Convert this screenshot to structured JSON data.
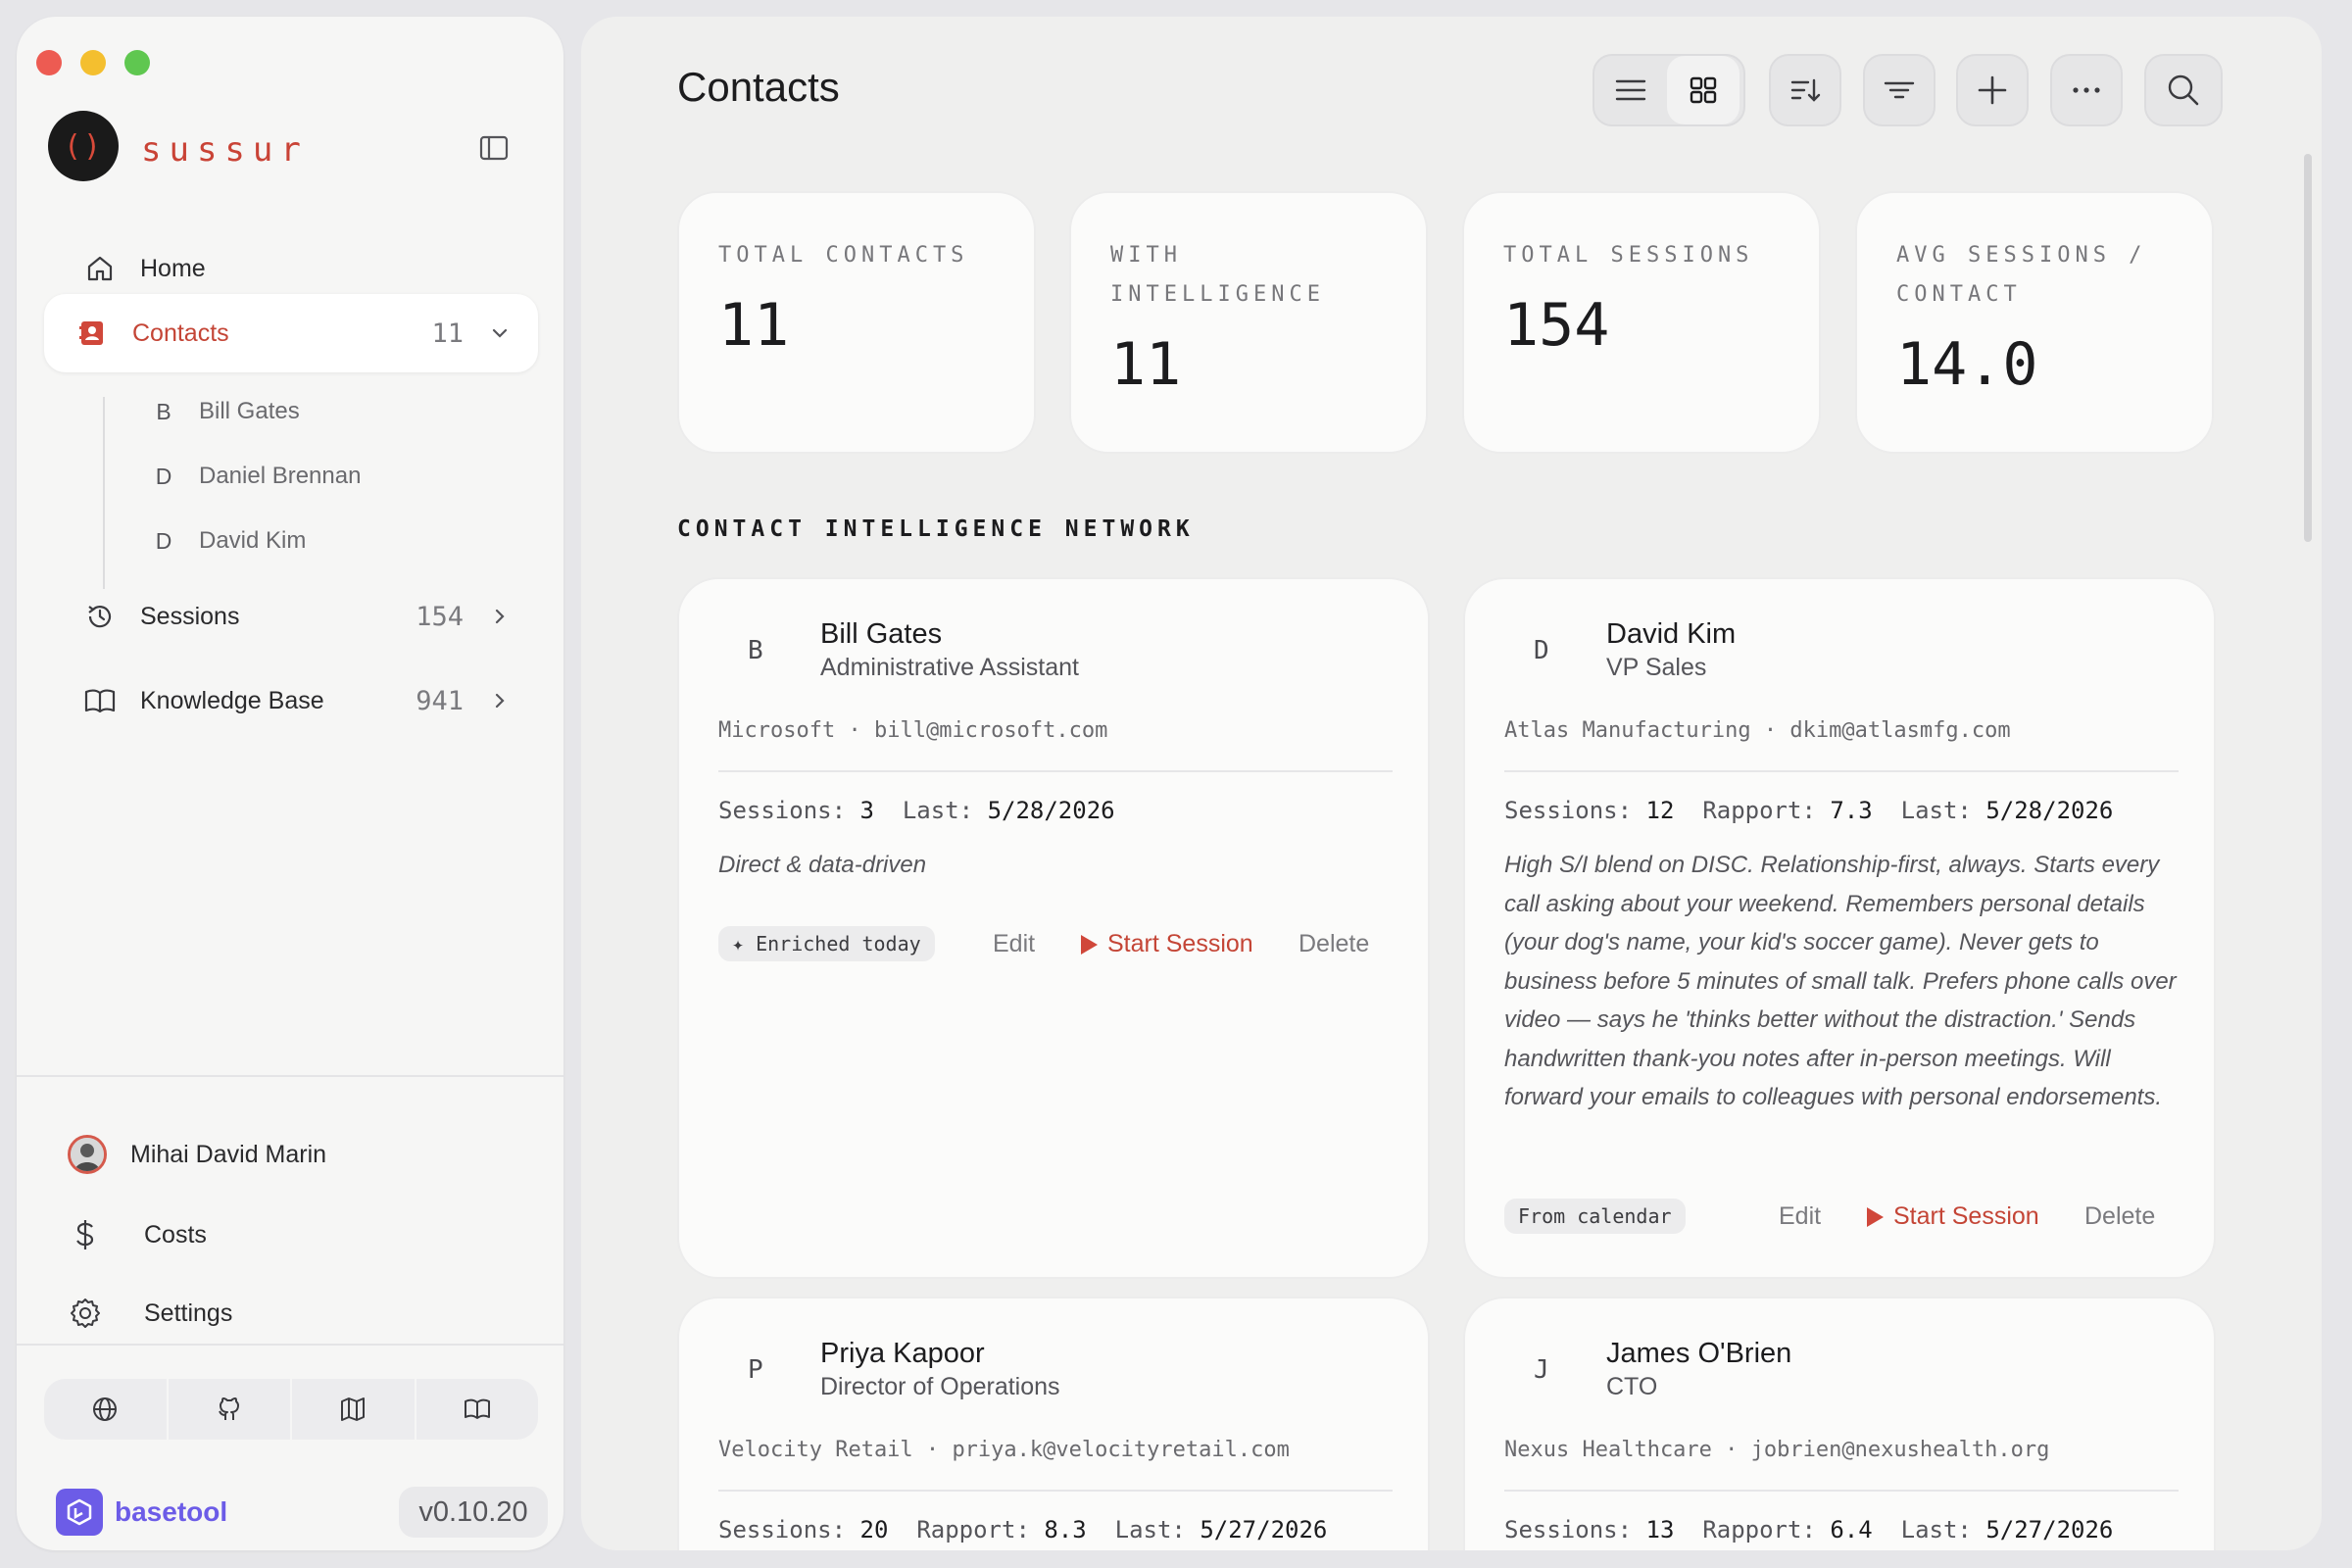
{
  "app": {
    "brand": "sussur",
    "logo_glyph": "()",
    "accent_color": "#c44536"
  },
  "sidebar": {
    "nav": [
      {
        "label": "Home",
        "icon": "home-icon"
      },
      {
        "label": "Contacts",
        "count": "11",
        "icon": "contacts-icon",
        "active": true
      },
      {
        "label": "Sessions",
        "count": "154",
        "icon": "history-icon"
      },
      {
        "label": "Knowledge Base",
        "count": "941",
        "icon": "book-icon"
      }
    ],
    "sub_contacts": [
      {
        "initial": "B",
        "name": "Bill Gates"
      },
      {
        "initial": "D",
        "name": "Daniel Brennan"
      },
      {
        "initial": "D",
        "name": "David Kim"
      }
    ],
    "user": {
      "name": "Mihai David Marin"
    },
    "footer": [
      {
        "label": "Costs",
        "icon": "dollar-icon"
      },
      {
        "label": "Settings",
        "icon": "gear-icon"
      }
    ],
    "links": [
      "globe-icon",
      "github-icon",
      "map-icon",
      "book-open-icon"
    ],
    "basetool": {
      "name": "basetool",
      "color": "#6c5ce7"
    },
    "version": "v0.10.20"
  },
  "main": {
    "title": "Contacts",
    "toolbar": [
      "list-view-icon",
      "grid-view-icon",
      "sort-icon",
      "filter-icon",
      "plus-icon",
      "more-icon",
      "search-icon"
    ],
    "stats": [
      {
        "label": "TOTAL CONTACTS",
        "value": "11"
      },
      {
        "label": "WITH INTELLIGENCE",
        "value": "11"
      },
      {
        "label": "TOTAL SESSIONS",
        "value": "154"
      },
      {
        "label": "AVG SESSIONS / CONTACT",
        "value": "14.0"
      }
    ],
    "section_title": "CONTACT INTELLIGENCE NETWORK",
    "contacts": [
      {
        "initial": "B",
        "name": "Bill Gates",
        "title": "Administrative Assistant",
        "company": "Microsoft",
        "email": "bill@microsoft.com",
        "sessions_label": "Sessions:",
        "sessions": "3",
        "last_label": "Last:",
        "last": "5/28/2026",
        "description": "Direct & data-driven",
        "tag": "✦ Enriched today",
        "edit": "Edit",
        "start": "Start Session",
        "delete": "Delete"
      },
      {
        "initial": "D",
        "name": "David Kim",
        "title": "VP Sales",
        "company": "Atlas Manufacturing",
        "email": "dkim@atlasmfg.com",
        "sessions_label": "Sessions:",
        "sessions": "12",
        "rapport_label": "Rapport:",
        "rapport": "7.3",
        "last_label": "Last:",
        "last": "5/28/2026",
        "description": "High S/I blend on DISC. Relationship-first, always. Starts every call asking about your weekend. Remembers personal details (your dog's name, your kid's soccer game). Never gets to business before 5 minutes of small talk. Prefers phone calls over video — says he 'thinks better without the distraction.' Sends handwritten thank-you notes after in-person meetings. Will forward your emails to colleagues with personal endorsements.",
        "tag": "From calendar",
        "edit": "Edit",
        "start": "Start Session",
        "delete": "Delete"
      },
      {
        "initial": "P",
        "name": "Priya Kapoor",
        "title": "Director of Operations",
        "company": "Velocity Retail",
        "email": "priya.k@velocityretail.com",
        "sessions_label": "Sessions:",
        "sessions": "20",
        "rapport_label": "Rapport:",
        "rapport": "8.3",
        "last_label": "Last:",
        "last": "5/27/2026"
      },
      {
        "initial": "J",
        "name": "James O'Brien",
        "title": "CTO",
        "company": "Nexus Healthcare",
        "email": "jobrien@nexushealth.org",
        "sessions_label": "Sessions:",
        "sessions": "13",
        "rapport_label": "Rapport:",
        "rapport": "6.4",
        "last_label": "Last:",
        "last": "5/27/2026"
      }
    ]
  }
}
